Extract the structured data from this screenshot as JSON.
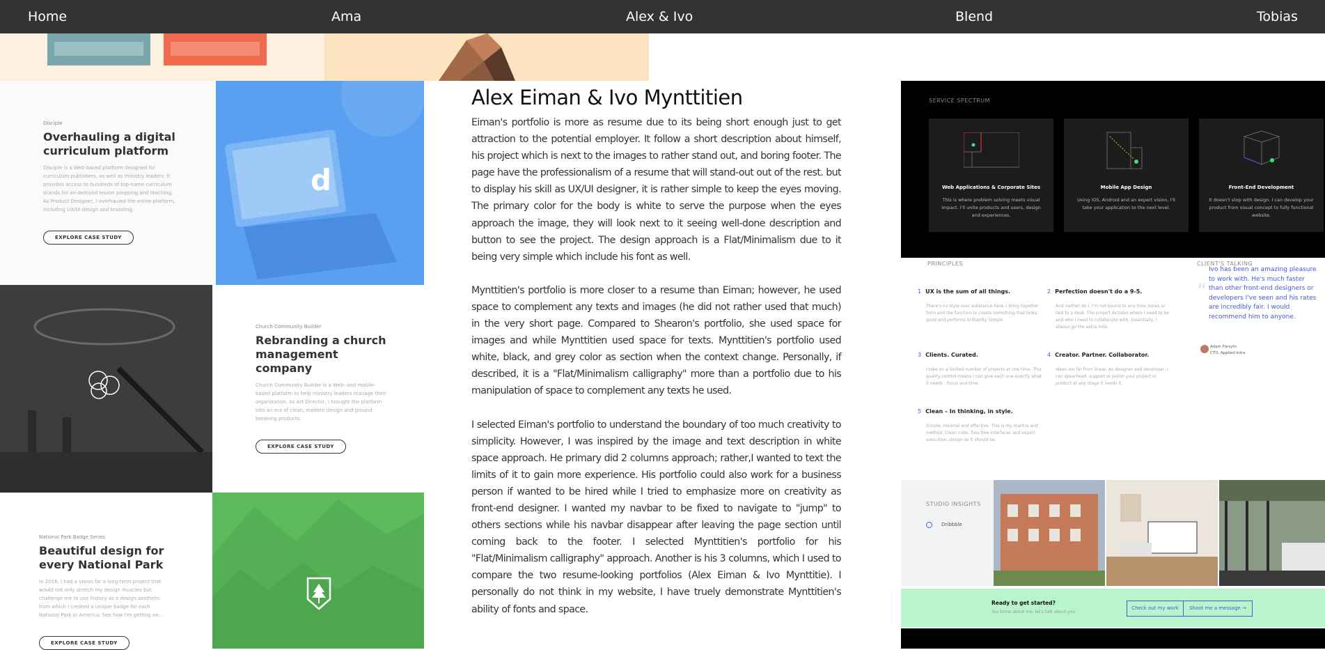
{
  "nav": {
    "items": [
      "Home",
      "Ama",
      "Alex & Ivo",
      "Blend",
      "Tobias"
    ]
  },
  "left": {
    "case1": {
      "subtitle": "Disciple",
      "title": "Overhauling a digital curriculum platform",
      "desc": "Disciple is a Web-based platform designed for curriculum publishers, as well as ministry leaders. It provides access to hundreds of top-name curriculum brands for on-demand lesson prepping and teaching. As Product Designer, I overhauled the entire platform, including UX/UI design and branding.",
      "button": "EXPLORE CASE STUDY"
    },
    "case2": {
      "subtitle": "Church Community Builder",
      "title": "Rebranding a church management company",
      "desc": "Church Community Builder is a Web- and mobile-based platform to help ministry leaders manage their organization. As Art Director, I brought the platform into an era of clean, modern design and ground-breaking products.",
      "button": "EXPLORE CASE STUDY"
    },
    "case3": {
      "subtitle": "National Park Badge Series",
      "title": "Beautiful design for every National Park",
      "desc": "In 2016, I had a vision for a long-term project that would not only stretch my design muscles but challenge me to use history as a design aesthetic from which I created a unique badge for each National Park in America. See how I'm getting on...",
      "button": "EXPLORE CASE STUDY"
    }
  },
  "article": {
    "title": "Alex Eiman & Ivo Mynttitien",
    "p1": "Eiman's portfolio is more as resume due to its being short enough just to get attraction to the potential employer. It follow a short description about himself, his project which is next to the images to rather stand out, and boring footer. The page have the professionalism of a resume that will stand-out out of the rest. but to display his skill as UX/UI designer, it is rather simple to keep the eyes moving. The primary color for the body is white to serve the purpose when the eyes approach the image, they will look next to it seeing well-done description and button to see the project. The design approach is a Flat/Minimalism due to it being very simple which include his font as well.",
    "p2": "Mynttitien's portfolio is more closer to a resume than Eiman; however, he used space to complement any texts and images (he did not rather used that much) in the very short page. Compared to Shearon's portfolio, she used space for images and while Mynttitien used space for texts. Mynttitien's portfolio used white, black, and grey color as section when the context change. Personally, if described, it is a \"Flat/Minimalism calligraphy\" more than a portfolio due to his manipulation of space to complement any texts he used.",
    "p3": "I selected Eiman's portfolio to understand the boundary of too much creativity to simplicity. However, I was inspired by the image and text description in white space approach. He primary did 2 columns approach; rather,I wanted to text the limits of it to gain more experience. His portfolio could also work for a business person if wanted to be hired while I tried to emphasize more on creativity as front-end designer. I wanted my navbar to be fixed to navigate to \"jump\" to others sections while his navbar disappear after leaving the page section until coming back to the footer. I selected Mynttitien's portfolio for his \"Flat/Minimalism calligraphy\" approach. Another is his 3 columns, which I used to compare the two resume-looking portfolios (Alex Eiman & Ivo Mynttitie). I personally do not think in my website, I have truely demonstrate Mynttitien's ability of fonts and space."
  },
  "right": {
    "service_label": "SERVICE SPECTRUM",
    "services": [
      {
        "title": "Web Applications & Corporate Sites",
        "desc": "This is where problem solving meets visual impact. I'll unite products and users, design and experiences."
      },
      {
        "title": "Mobile App Design",
        "desc": "Using iOS, Android and an expert vision, I'll take your application to the next level."
      },
      {
        "title": "Front-End Development",
        "desc": "It doesn't stop with design. I can develop your product from visual concept to fully functional website."
      }
    ],
    "principles_label": "PRINCIPLES",
    "principles": [
      {
        "num": "1",
        "title": "UX is the sum of all things.",
        "desc": "There's no style over substance here. I bring together form and the function to create something that looks good and performs brilliantly. Simple."
      },
      {
        "num": "2",
        "title": "Perfection doesn't do a 9-5.",
        "desc": "And neither do I. I'm not bound to any time zones or tied to a desk. The project dictates where I need to be and who I need to collaborate with. Essentially, I always go the extra mile."
      },
      {
        "num": "3",
        "title": "Clients. Curated.",
        "desc": "I take on a limited number of projects at one time. This quality control means I can give each one exactly what it needs - focus and time."
      },
      {
        "num": "4",
        "title": "Creator. Partner. Collaborator.",
        "desc": "Ideas are far from linear. As designer and developer, I can spearhead, support or polish your project or product at any stage it needs it."
      },
      {
        "num": "5",
        "title": "Clean – In thinking, in style.",
        "desc": "Simple, minimal and effective. This is my mantra and method. Clean code, fuss-free interfaces and expert execution, design as it should be."
      }
    ],
    "clients_label": "CLIENT'S TALKING",
    "quote": "Ivo has been an amazing pleasure to work with. He's much faster than other front-end designers or developers I've seen and his rates are incredibly fair. I would recommend him to anyone.",
    "author_name": "Adam Forsyth",
    "author_role": "CTO, Applied Intra",
    "insights_label": "STUDIO INSIGHTS",
    "dribbble": "Dribbble",
    "cta_title": "Ready to get started?",
    "cta_sub": "You know about me, let's talk about you.",
    "cta_btn1": "Check out my work",
    "cta_btn2": "Shoot me a message  →"
  }
}
